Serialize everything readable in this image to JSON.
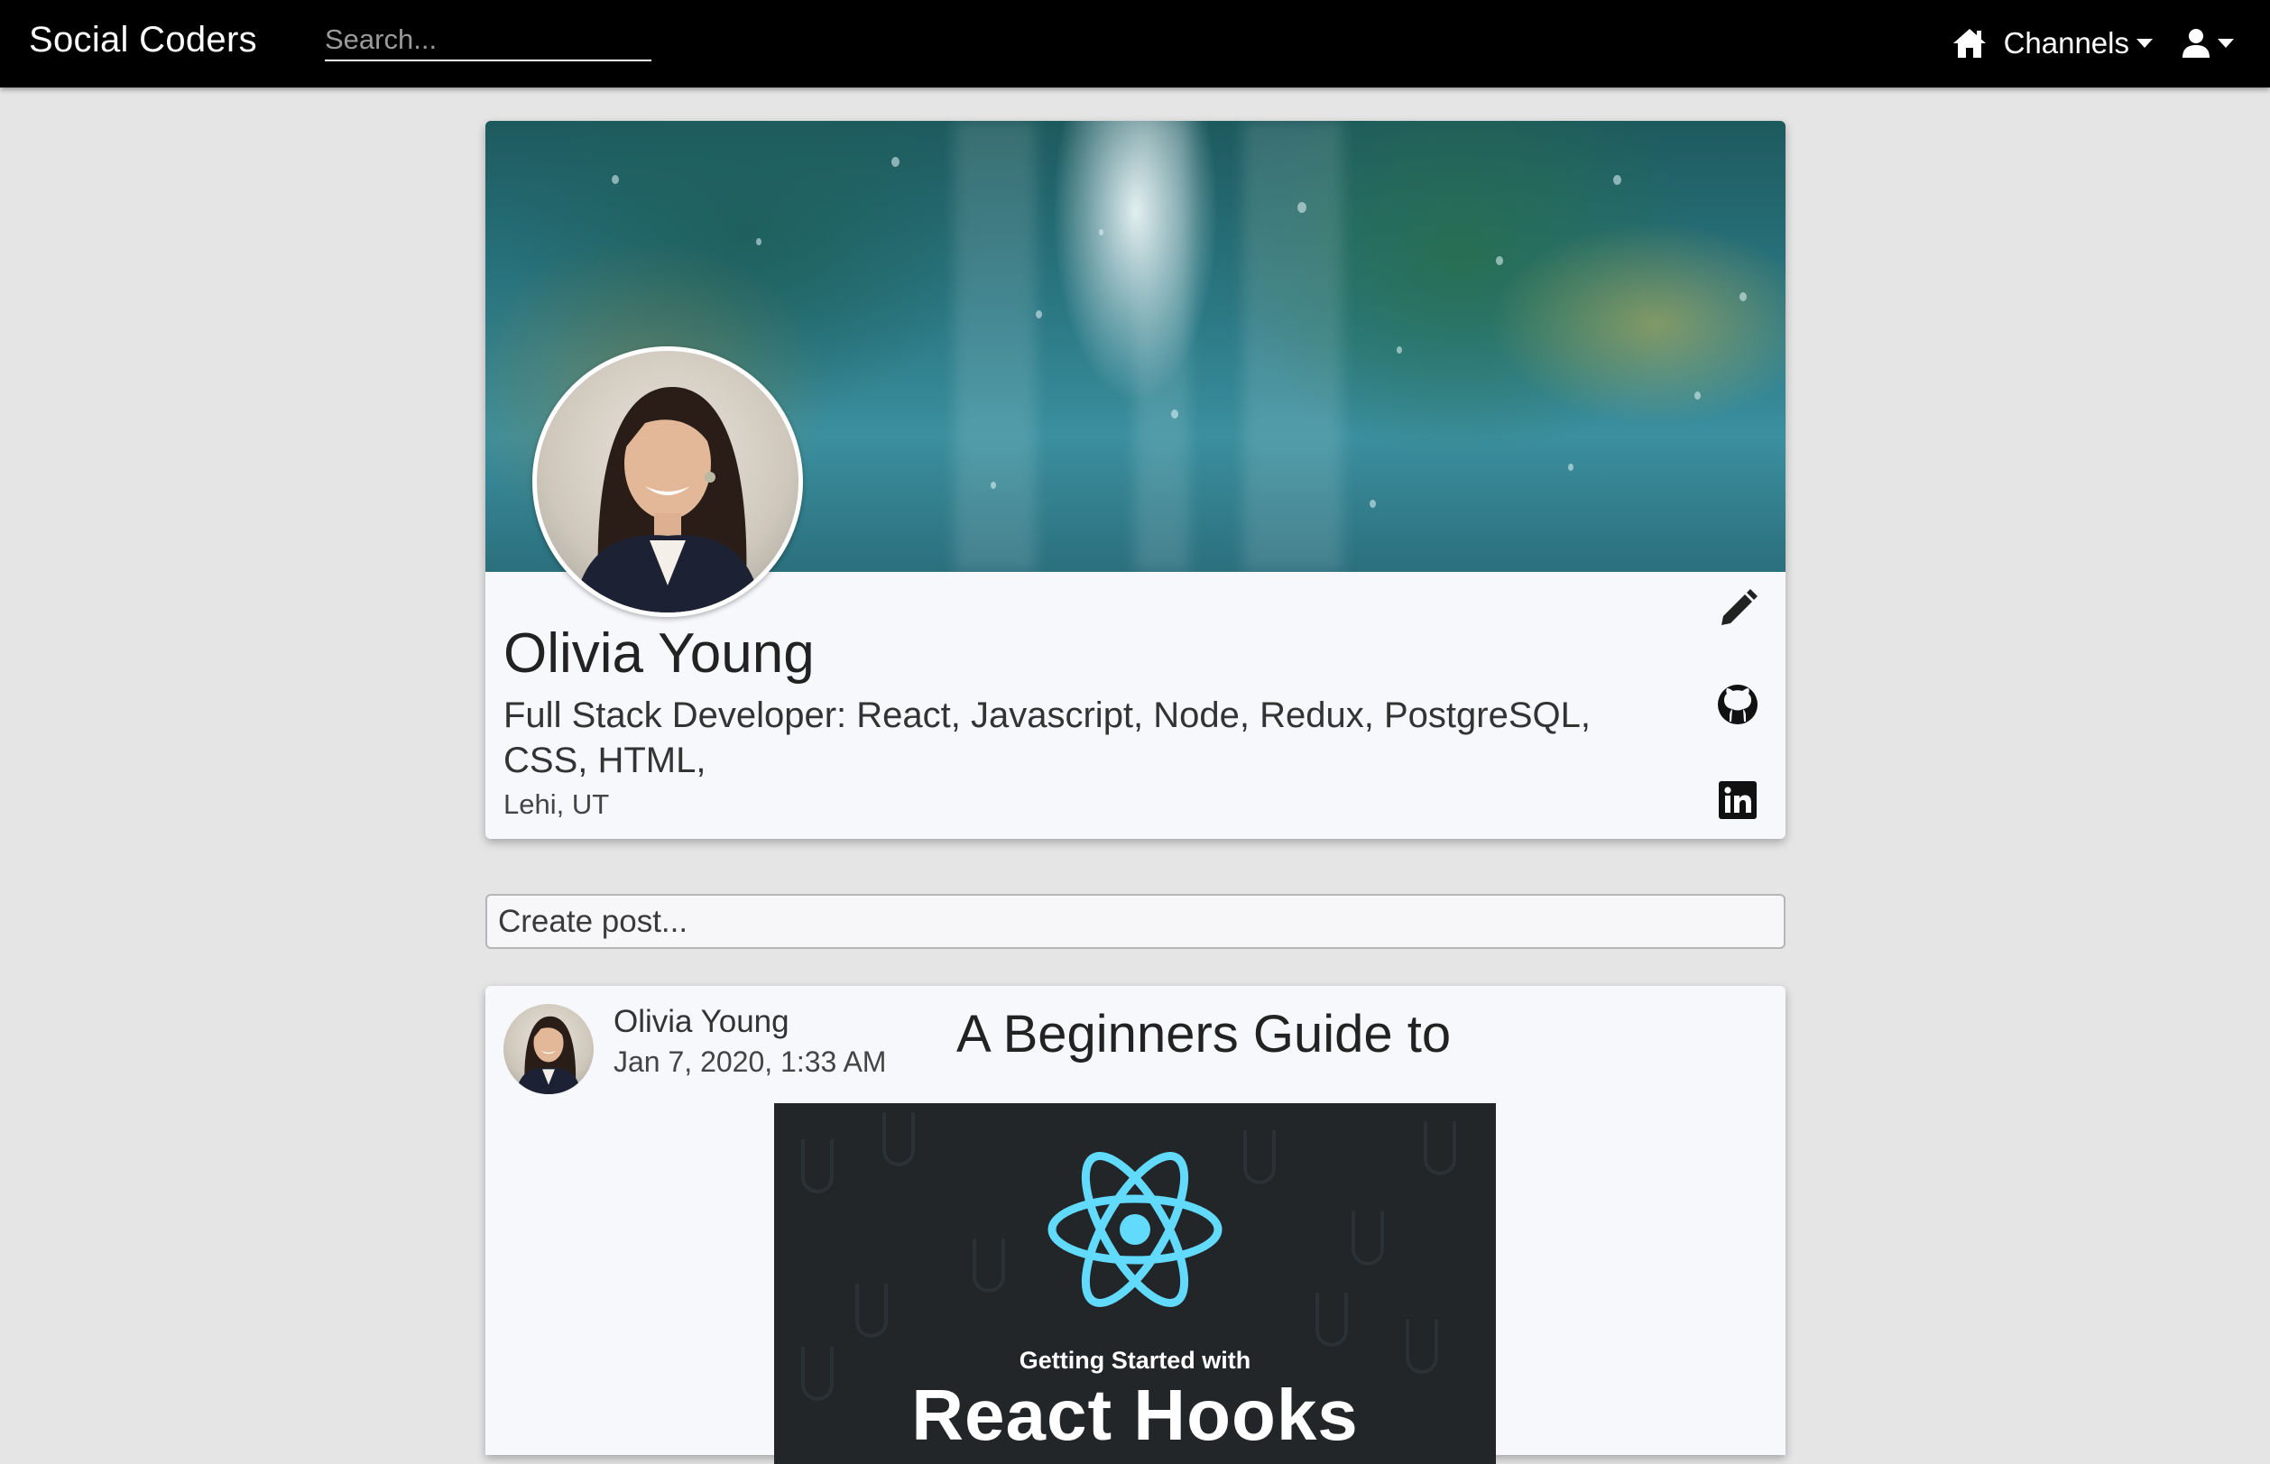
{
  "navbar": {
    "brand": "Social Coders",
    "search_placeholder": "Search...",
    "home_icon": "home-icon",
    "channels_label": "Channels",
    "user_icon": "user-icon"
  },
  "profile": {
    "name": "Olivia Young",
    "headline": "Full Stack Developer: React, Javascript, Node, Redux, PostgreSQL, CSS, HTML,",
    "location": "Lehi, UT",
    "actions": [
      "edit-icon",
      "github-icon",
      "linkedin-icon"
    ]
  },
  "create_post": {
    "placeholder": "Create post..."
  },
  "posts": [
    {
      "author": "Olivia Young",
      "date": "Jan 7, 2020, 1:33 AM",
      "title": "A Beginners Guide to",
      "image_subtitle": "Getting Started with",
      "image_title": "React Hooks"
    }
  ],
  "colors": {
    "navbar_bg": "#000000",
    "page_bg": "#e5e5e5",
    "card_bg": "#f7f8fc",
    "react_blue": "#61dafb",
    "image_bg": "#222629"
  }
}
